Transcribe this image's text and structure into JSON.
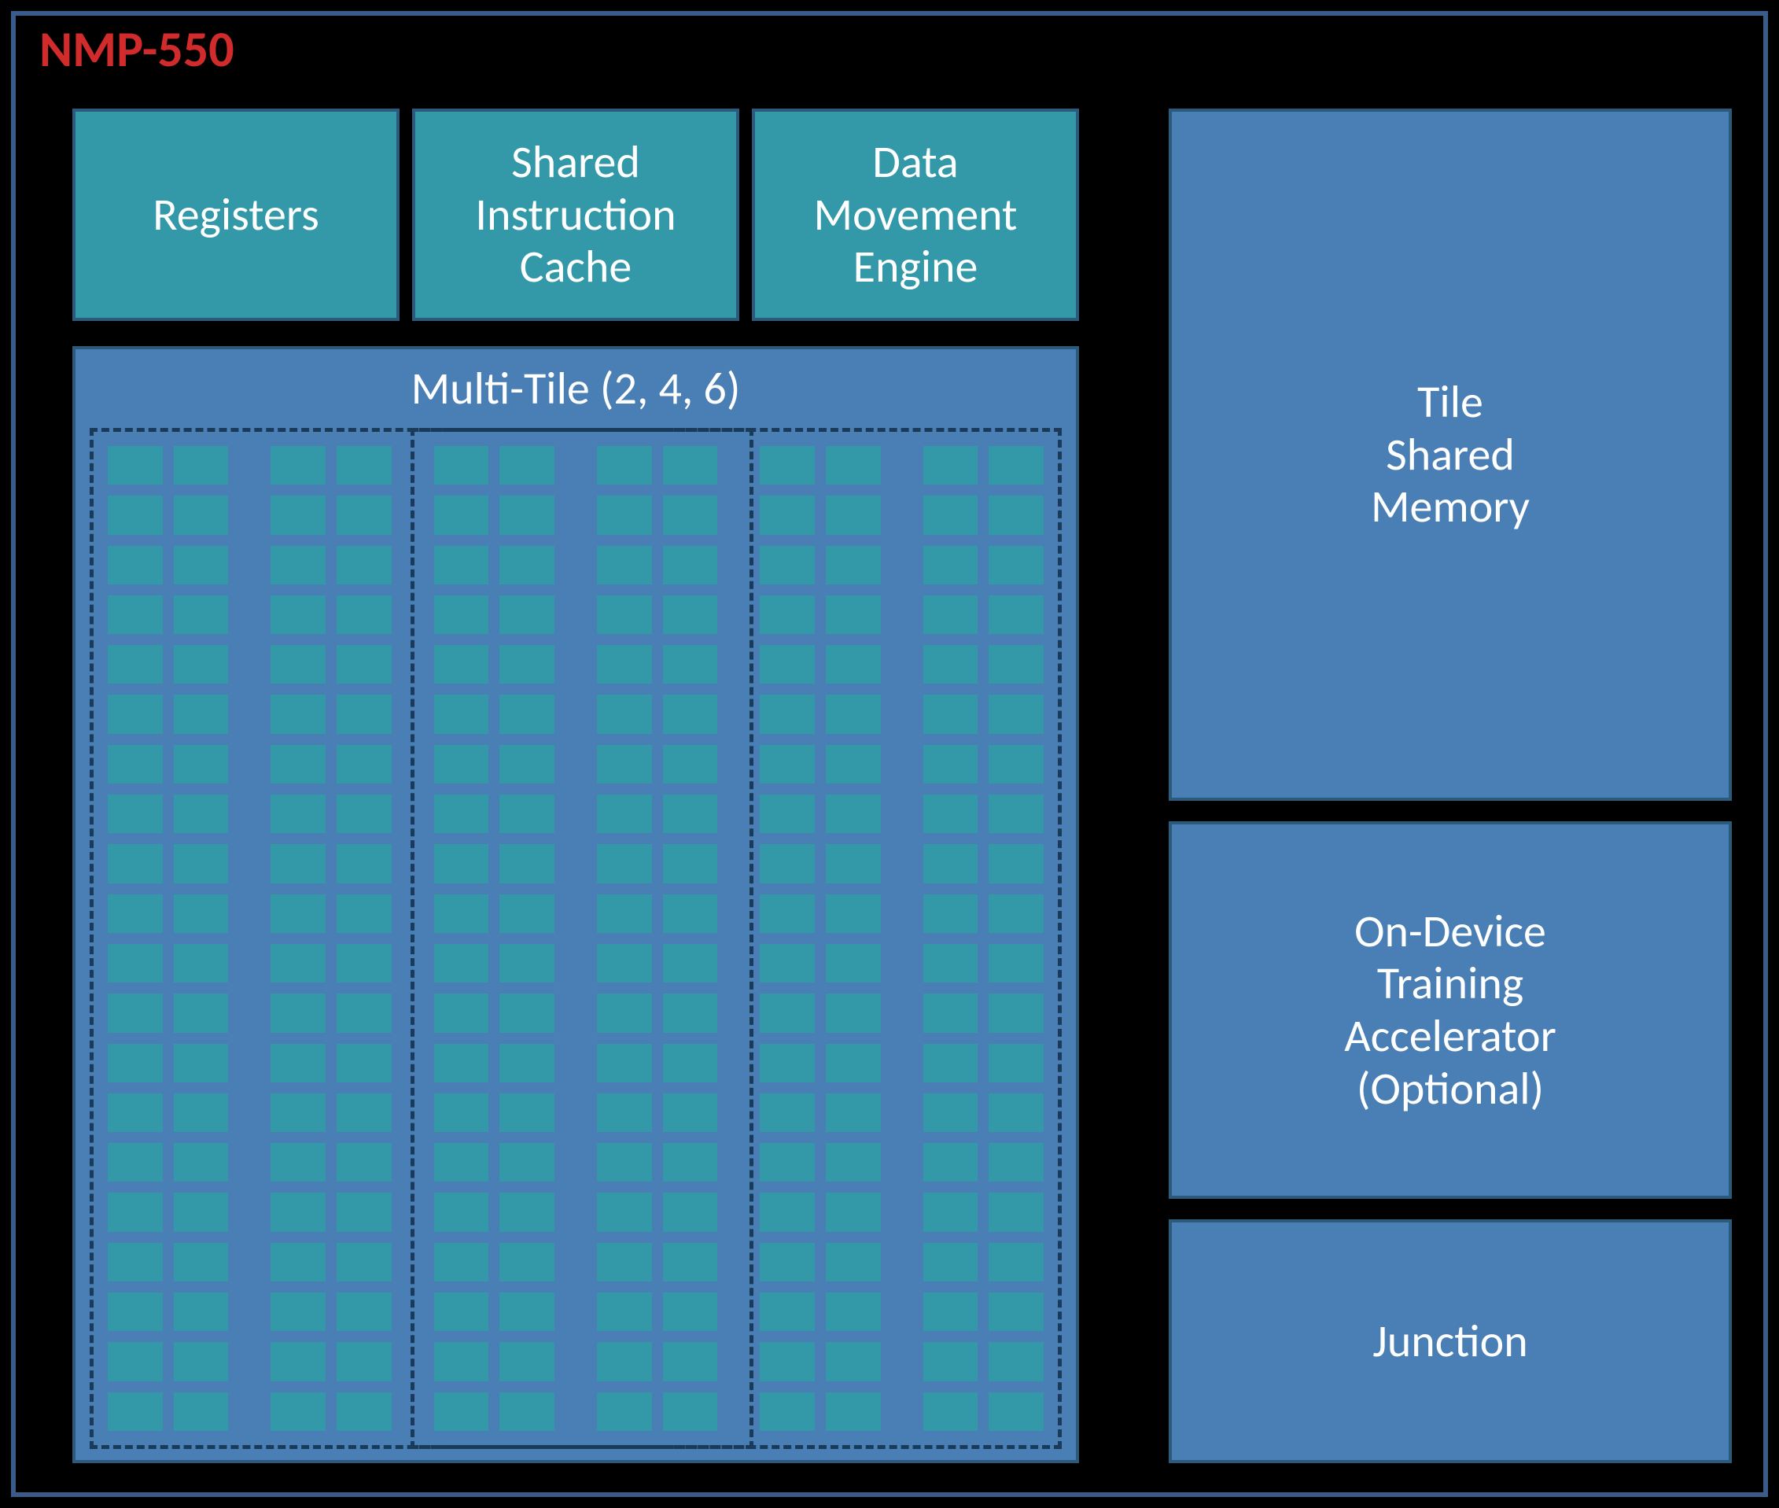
{
  "title": "NMP-550",
  "blocks": {
    "registers": "Registers",
    "icache": "Shared\nInstruction\nCache",
    "dme": "Data\nMovement\nEngine",
    "multitile": "Multi-Tile (2, 4, 6)",
    "tsm": "Tile\nShared\nMemory",
    "odta": "On-Device\nTraining\nAccelerator\n(Optional)",
    "junction": "Junction"
  },
  "grid": {
    "rows": 20,
    "column_pairs": 6
  }
}
